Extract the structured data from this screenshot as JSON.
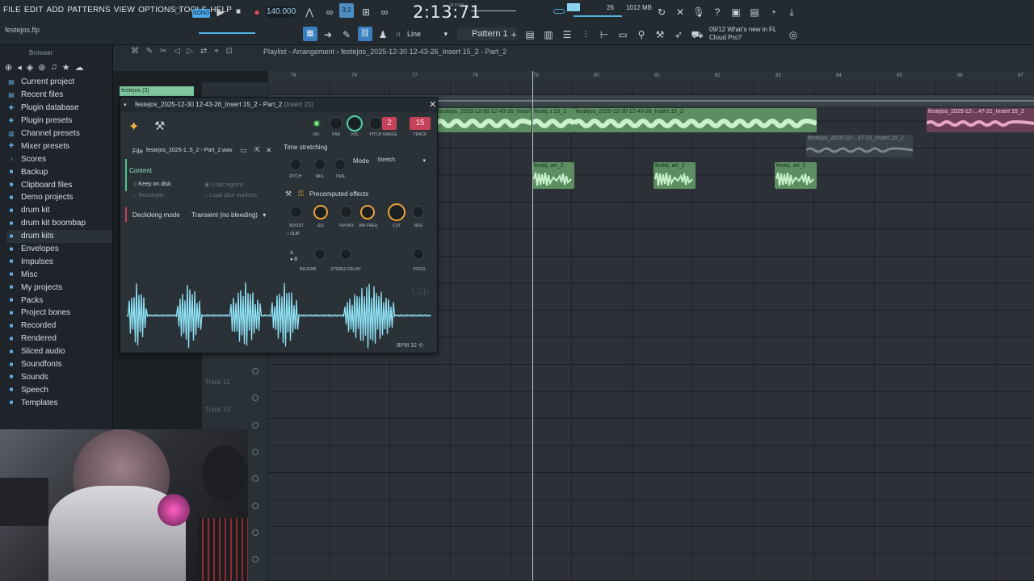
{
  "menu": [
    "FILE",
    "EDIT",
    "ADD",
    "PATTERNS",
    "VIEW",
    "OPTIONS",
    "TOOLS",
    "HELP"
  ],
  "transport": {
    "song_mode": "SONG",
    "tempo": "140.000",
    "time": "2:13:71",
    "time_unit": "M:S:CS",
    "cpu": "26",
    "memory": "1012 MB",
    "pattern_mode_value": "3.2"
  },
  "project_file": "festejos.flp",
  "toolbar": {
    "snap": "Line",
    "pattern": "Pattern 1"
  },
  "news": {
    "date": "09/12",
    "line1": "What's new in FL",
    "line2": "Cloud Pro?"
  },
  "browser": {
    "title": "Browser",
    "items": [
      {
        "label": "Current project",
        "icon": "doc-icon"
      },
      {
        "label": "Recent files",
        "icon": "doc-icon"
      },
      {
        "label": "Plugin database",
        "icon": "plug-icon"
      },
      {
        "label": "Plugin presets",
        "icon": "plug-icon"
      },
      {
        "label": "Channel presets",
        "icon": "channel-icon"
      },
      {
        "label": "Mixer presets",
        "icon": "mixer-icon"
      },
      {
        "label": "Scores",
        "icon": "note-icon"
      },
      {
        "label": "Backup",
        "icon": "folder-icon"
      },
      {
        "label": "Clipboard files",
        "icon": "folder-icon"
      },
      {
        "label": "Demo projects",
        "icon": "folder-icon"
      },
      {
        "label": "drum kit",
        "icon": "folder-icon"
      },
      {
        "label": "drum kit boombap",
        "icon": "folder-icon"
      },
      {
        "label": "drum kits",
        "icon": "folder-icon"
      },
      {
        "label": "Envelopes",
        "icon": "folder-icon"
      },
      {
        "label": "Impulses",
        "icon": "folder-icon"
      },
      {
        "label": "Misc",
        "icon": "folder-icon"
      },
      {
        "label": "My projects",
        "icon": "folder-icon"
      },
      {
        "label": "Packs",
        "icon": "folder-icon"
      },
      {
        "label": "Project bones",
        "icon": "folder-icon"
      },
      {
        "label": "Recorded",
        "icon": "folder-icon"
      },
      {
        "label": "Rendered",
        "icon": "folder-icon"
      },
      {
        "label": "Sliced audio",
        "icon": "folder-icon"
      },
      {
        "label": "Soundfonts",
        "icon": "folder-icon"
      },
      {
        "label": "Sounds",
        "icon": "folder-icon"
      },
      {
        "label": "Speech",
        "icon": "folder-icon"
      },
      {
        "label": "Templates",
        "icon": "folder-icon"
      }
    ]
  },
  "playlist": {
    "title": "Playlist - Arrangement",
    "breadcrumb": "festejos_2025-12-30 12-43-26_Insert 15_2 - Part_2",
    "bars": [
      "76",
      "76",
      "77",
      "78",
      "79",
      "80",
      "81",
      "82",
      "83",
      "84",
      "85",
      "86",
      "87"
    ],
    "tracks": [
      "Track 12",
      "Track 13"
    ],
    "clips": {
      "main": "festejos_2025-12-30 12-43-26_Insert 15_2",
      "a": "festej..t 15_2",
      "b": "festejos_2025-12-30 12-43-26_Insert 15_2",
      "pink": "festejos_2025-12-...47-21_Insert 15_2",
      "grey": "festejos_2025-12-...47-21_Insert 15_2",
      "small": "festej..art_2"
    }
  },
  "channel_window": {
    "tab": "festejos (3)",
    "title": "festejos_2025-12-30 12-43-26_Insert 15_2 - Part_2",
    "insert": "(Insert 15)",
    "pitch_range": "2",
    "track": "15",
    "knob_labels": {
      "on": "ON",
      "pan": "PAN",
      "vol": "VOL",
      "pitch": "PITCH",
      "range": "RANGE",
      "track": "TRACK"
    },
    "file_label": "File",
    "file_name": "festejos_2025-1..5_2 - Part_2.wav",
    "content_label": "Content",
    "keep_on_disk": "Keep on disk",
    "resample": "Resample",
    "load_regions": "Load regions",
    "load_slice_markers": "Load slice markers",
    "declicking_label": "Declicking mode",
    "declicking_value": "Transient (no bleeding)",
    "time_stretching": "Time stretching",
    "ts_knobs": [
      "PITCH",
      "MUL",
      "TIME"
    ],
    "mode_label": "Mode",
    "mode_value": "Stretch",
    "precompute": "Precomputed effects",
    "fx_knobs": [
      "BOOST",
      "EQ",
      "RM MIX",
      "RM FREQ",
      "CUT",
      "RES"
    ],
    "clip_label": "CLIP",
    "ab_a": "A",
    "ab_b": "B",
    "reverb": "REVERB",
    "stereo_delay": "STEREO DELAY",
    "pogo": "POGO",
    "wave_clip_label": "Clip",
    "bpm": "BPM",
    "bpm_val": "32"
  },
  "colors": {
    "accent_orange": "#f0a338",
    "wave_cyan": "#8fe3f7",
    "clip_green": "#7cc480",
    "clip_pink": "#d8779f",
    "track_red": "#c6415a"
  }
}
